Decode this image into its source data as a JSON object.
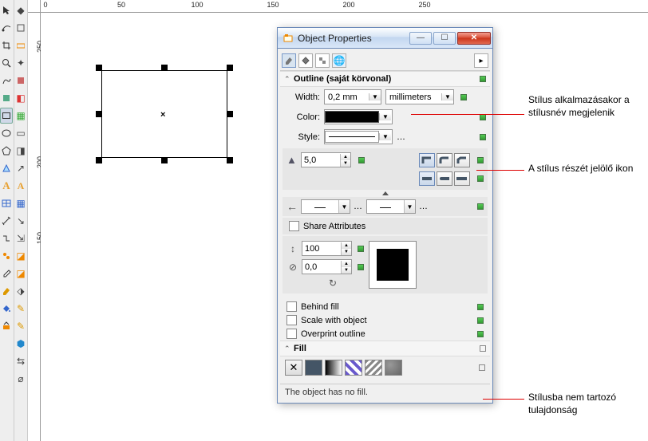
{
  "ruler": {
    "h": [
      "0",
      "50",
      "100",
      "150",
      "200",
      "250"
    ],
    "v": [
      "250",
      "200",
      "150"
    ]
  },
  "dialog": {
    "title": "Object Properties",
    "section_outline": "Outline (saját körvonal)",
    "width_label": "Width:",
    "width_value": "0,2 mm",
    "units": "millimeters",
    "color_label": "Color:",
    "style_label": "Style:",
    "miter_value": "5,0",
    "share_attr": "Share Attributes",
    "stretch_value": "100",
    "angle_value": "0,0",
    "behind_fill": "Behind fill",
    "scale_with": "Scale with object",
    "overprint": "Overprint outline",
    "section_fill": "Fill",
    "status": "The object has no fill."
  },
  "annotations": {
    "a1": "Stílus alkalmazásakor a stílusnév megjelenik",
    "a2": "A stílus részét jelölő ikon",
    "a3": "Stílusba nem tartozó tulajdonság"
  }
}
